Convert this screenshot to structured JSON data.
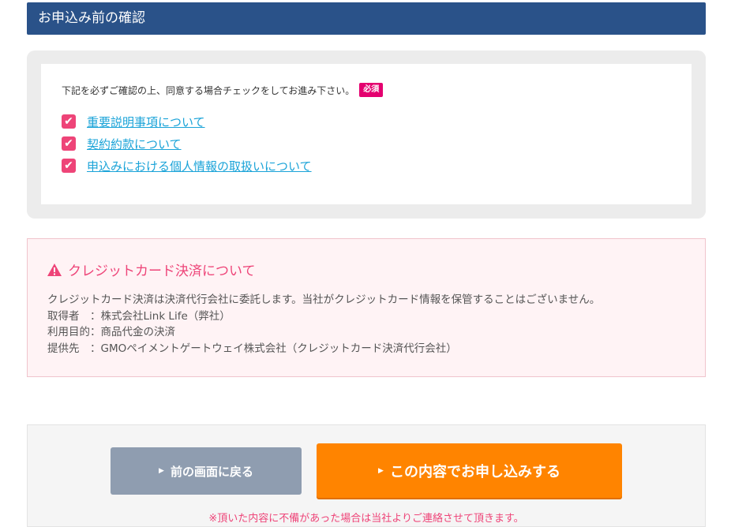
{
  "header": {
    "title": "お申込み前の確認"
  },
  "consent": {
    "instruction": "下記を必ずご確認の上、同意する場合チェックをしてお進み下さい。",
    "required_label": "必須",
    "items": [
      {
        "label": "重要説明事項について",
        "checked": true
      },
      {
        "label": "契約約款について",
        "checked": true
      },
      {
        "label": "申込みにおける個人情報の取扱いについて",
        "checked": true
      }
    ]
  },
  "notice": {
    "title": "クレジットカード決済について",
    "lines": [
      "クレジットカード決済は決済代行会社に委託します。当社がクレジットカード情報を保管することはございません。",
      "取得者　：株式会社Link Life（弊社）",
      "利用目的：商品代金の決済",
      "提供先　：GMOペイメントゲートウェイ株式会社（クレジットカード決済代行会社）"
    ]
  },
  "actions": {
    "back_label": "前の画面に戻る",
    "submit_label": "この内容でお申し込みする",
    "note": "※頂いた内容に不備があった場合は当社よりご連絡させて頂きます。"
  },
  "colors": {
    "header_bg": "#2a5289",
    "accent_pink": "#ee4478",
    "link_blue": "#1aa3d8",
    "submit_orange": "#ff8400",
    "back_gray": "#8f9db0"
  }
}
